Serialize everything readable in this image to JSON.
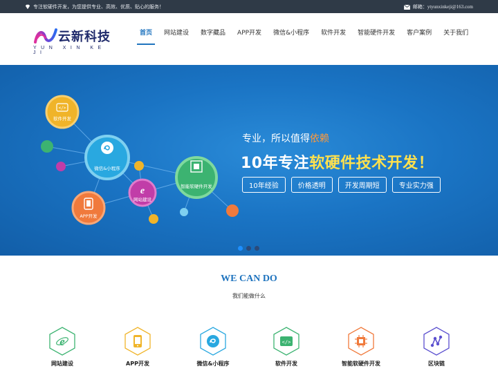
{
  "topbar": {
    "slogan": "专注软硬件开发，为您提供专业、高效、优质、贴心的服务！",
    "email": "邮箱：ytyunxinkeji@163.com"
  },
  "logo": {
    "title": "云新科技",
    "subtitle": "YUN XIN KE JI"
  },
  "nav": [
    "首页",
    "网站建设",
    "数字藏品",
    "APP开发",
    "微信&小程序",
    "软件开发",
    "智能硬件开发",
    "客户案例",
    "关于我们"
  ],
  "banner": {
    "nodes": {
      "software": "软件开发",
      "wechat": "微信&小程序",
      "hardware": "智能软硬件开发",
      "web": "网站建设",
      "app": "APP开发"
    },
    "slogan_prefix": "专业，所以值得",
    "slogan_highlight": "依赖",
    "headline_prefix": "10年专注",
    "headline_highlight": "软硬件技术开发！",
    "tags": [
      "10年经验",
      "价格透明",
      "开发周期短",
      "专业实力强"
    ]
  },
  "section": {
    "title": "WE CAN DO",
    "subtitle": "我们能做什么"
  },
  "services": [
    {
      "label": "网站建设",
      "color": "#3cb371",
      "icon": "ie-icon"
    },
    {
      "label": "APP开发",
      "color": "#f0b429",
      "icon": "phone-icon"
    },
    {
      "label": "微信&小程序",
      "color": "#29a8e0",
      "icon": "miniprogram-icon"
    },
    {
      "label": "软件开发",
      "color": "#3cb371",
      "icon": "code-icon"
    },
    {
      "label": "智能软硬件开发",
      "color": "#f07a3c",
      "icon": "chip-icon"
    },
    {
      "label": "区块链",
      "color": "#5a4fcf",
      "icon": "blockchain-icon"
    }
  ]
}
